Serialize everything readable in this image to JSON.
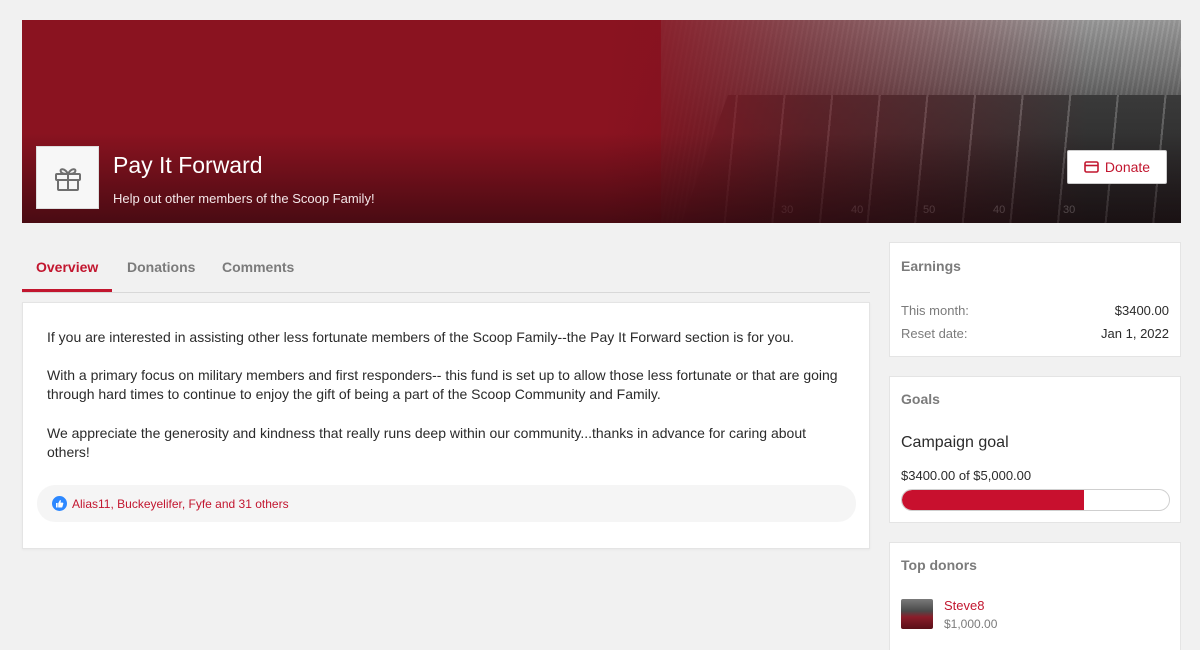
{
  "header": {
    "title": "Pay It Forward",
    "subtitle": "Help out other members of the Scoop Family!",
    "donate_label": "Donate",
    "banner_yard_numbers": [
      "30",
      "40",
      "50",
      "40",
      "30"
    ]
  },
  "tabs": [
    {
      "label": "Overview",
      "active": true
    },
    {
      "label": "Donations",
      "active": false
    },
    {
      "label": "Comments",
      "active": false
    }
  ],
  "overview": {
    "paragraphs": [
      "If you are interested in assisting other less fortunate members of the Scoop Family--the Pay It Forward section is for you.",
      "With a primary focus on military members and first responders-- this fund is set up to allow those less fortunate or that are going through hard times to continue to enjoy the gift of being a part of the Scoop Community and Family.",
      "We appreciate the generosity and kindness that really runs deep within our community...thanks in advance for caring about others!"
    ],
    "reactions_text": "Alias11, Buckeyelifer, Fyfe and 31 others"
  },
  "earnings": {
    "title": "Earnings",
    "this_month_label": "This month:",
    "this_month_value": "$3400.00",
    "reset_label": "Reset date:",
    "reset_value": "Jan 1, 2022"
  },
  "goals": {
    "title": "Goals",
    "campaign_name": "Campaign goal",
    "progress_text": "$3400.00 of $5,000.00",
    "progress_fraction": 0.68
  },
  "top_donors": {
    "title": "Top donors",
    "donors": [
      {
        "name": "Steve8",
        "amount": "$1,000.00"
      }
    ]
  },
  "colors": {
    "accent": "#c2162f",
    "banner_red": "#8e1421",
    "page_bg": "#f1f1f1"
  }
}
